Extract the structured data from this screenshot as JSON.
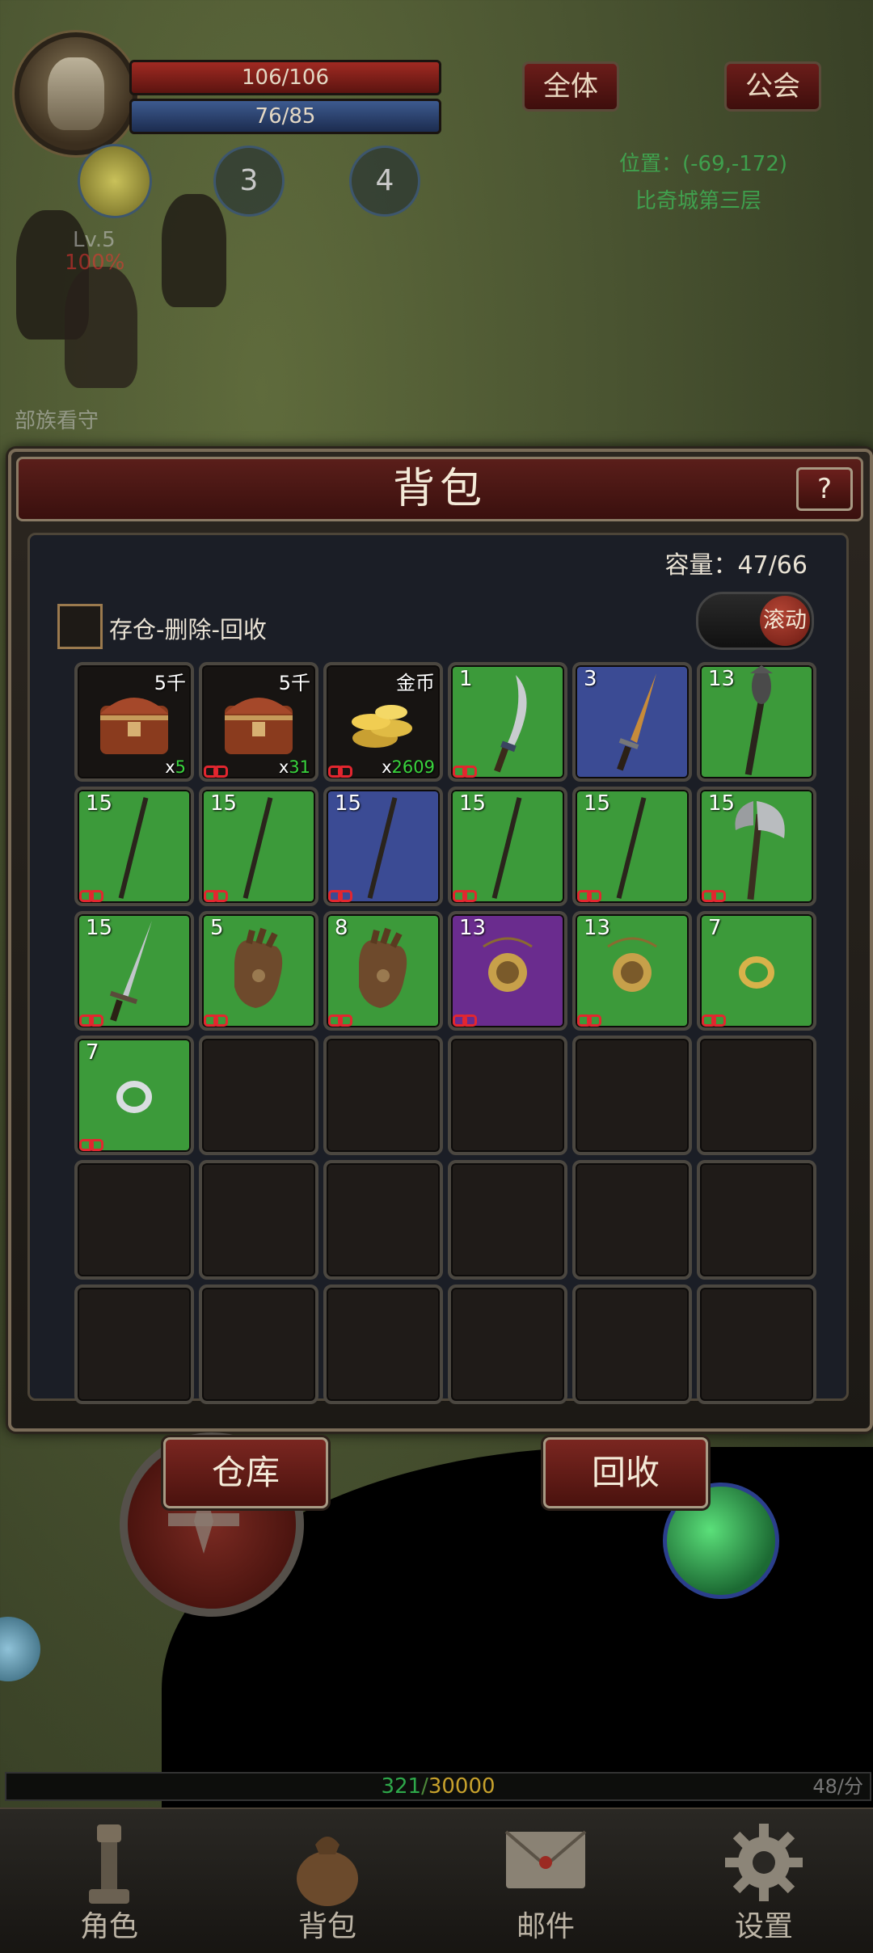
{
  "hud": {
    "hp": "106/106",
    "mp": "76/85",
    "skill_slots": [
      "3",
      "4"
    ],
    "chat_tabs": [
      "全体",
      "公会"
    ],
    "position": "位置：(-69,-172)",
    "location_name": "比奇城第三层"
  },
  "world_labels": {
    "npc_name": "部族看守",
    "npc_level": "Lv.5",
    "npc_hp": "100%"
  },
  "bag": {
    "title": "背包",
    "help": "?",
    "capacity": "容量：47/66",
    "store_label": "存仓-删除-回收",
    "scroll_toggle": "滚动",
    "items": [
      {
        "bg": "dark",
        "art": "chest",
        "tag": "5千",
        "qty_prefix": "x",
        "qty": "5",
        "locked": false
      },
      {
        "bg": "dark",
        "art": "chest",
        "tag": "5千",
        "qty_prefix": "x",
        "qty": "31",
        "locked": true
      },
      {
        "bg": "dark",
        "art": "coins",
        "tag": "金币",
        "qty_prefix": "x",
        "qty": "2609",
        "locked": true
      },
      {
        "bg": "green",
        "art": "blade",
        "level": "1",
        "locked": true
      },
      {
        "bg": "blue",
        "art": "dagger",
        "level": "3",
        "locked": false
      },
      {
        "bg": "green",
        "art": "mace",
        "level": "13",
        "locked": false
      },
      {
        "bg": "green",
        "art": "staff",
        "level": "15",
        "locked": true
      },
      {
        "bg": "green",
        "art": "staff",
        "level": "15",
        "locked": true
      },
      {
        "bg": "blue",
        "art": "staff",
        "level": "15",
        "locked": true
      },
      {
        "bg": "green",
        "art": "staff",
        "level": "15",
        "locked": true
      },
      {
        "bg": "green",
        "art": "staff",
        "level": "15",
        "locked": true
      },
      {
        "bg": "green",
        "art": "axe",
        "level": "15",
        "locked": true
      },
      {
        "bg": "green",
        "art": "sword",
        "level": "15",
        "locked": true
      },
      {
        "bg": "green",
        "art": "glove",
        "level": "5",
        "locked": true
      },
      {
        "bg": "green",
        "art": "glove",
        "level": "8",
        "locked": true
      },
      {
        "bg": "purple",
        "art": "necklace",
        "level": "13",
        "locked": true
      },
      {
        "bg": "green",
        "art": "necklace",
        "level": "13",
        "locked": true
      },
      {
        "bg": "green",
        "art": "ring-gold",
        "level": "7",
        "locked": true
      },
      {
        "bg": "green",
        "art": "ring-silver",
        "level": "7",
        "locked": true
      }
    ],
    "total_slots": 36,
    "warehouse_button": "仓库",
    "recycle_button": "回收"
  },
  "exp": {
    "current": "321",
    "separator": "/",
    "max": "30000",
    "rate": "48/分"
  },
  "nav": [
    {
      "label": "角色",
      "icon": "character-icon"
    },
    {
      "label": "背包",
      "icon": "bag-icon"
    },
    {
      "label": "邮件",
      "icon": "mail-icon"
    },
    {
      "label": "设置",
      "icon": "gear-icon"
    }
  ]
}
